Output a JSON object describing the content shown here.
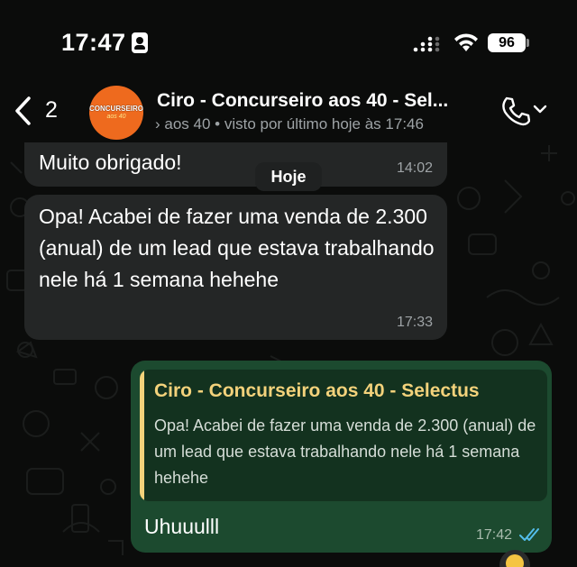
{
  "status_bar": {
    "time": "17:47",
    "battery": "96"
  },
  "header": {
    "back_count": "2",
    "avatar_text": "CONCURSEIRO",
    "avatar_sub": "aos 40",
    "contact_name": "Ciro - Concurseiro aos 40 - Sel...",
    "status": "› aos 40 • visto por último hoje às 17:46"
  },
  "date_separator": "Hoje",
  "messages": [
    {
      "text": "Muito obrigado!",
      "time": "14:02"
    },
    {
      "text": "Opa! Acabei de fazer uma venda de 2.300 (anual) de um lead que estava trabalhando nele há 1 semana  hehehe",
      "time": "17:33"
    }
  ],
  "reply": {
    "quote_author": "Ciro - Concurseiro aos 40 - Selectus",
    "quote_text": "Opa! Acabei de fazer uma venda de 2.300 (anual) de um lead que estava trabalhando nele há 1 semana  hehehe",
    "text": "Uhuuulll",
    "time": "17:42"
  },
  "colors": {
    "incoming_bubble": "#242626",
    "outgoing_bubble": "#1c4a2f",
    "quote_accent": "#f3d27b",
    "read_ticks": "#53bdeb",
    "avatar_bg": "#ee6a1e"
  },
  "icons": {
    "back": "chevron-left-icon",
    "call": "phone-icon",
    "dropdown": "chevron-down-icon",
    "read": "double-check-icon"
  }
}
